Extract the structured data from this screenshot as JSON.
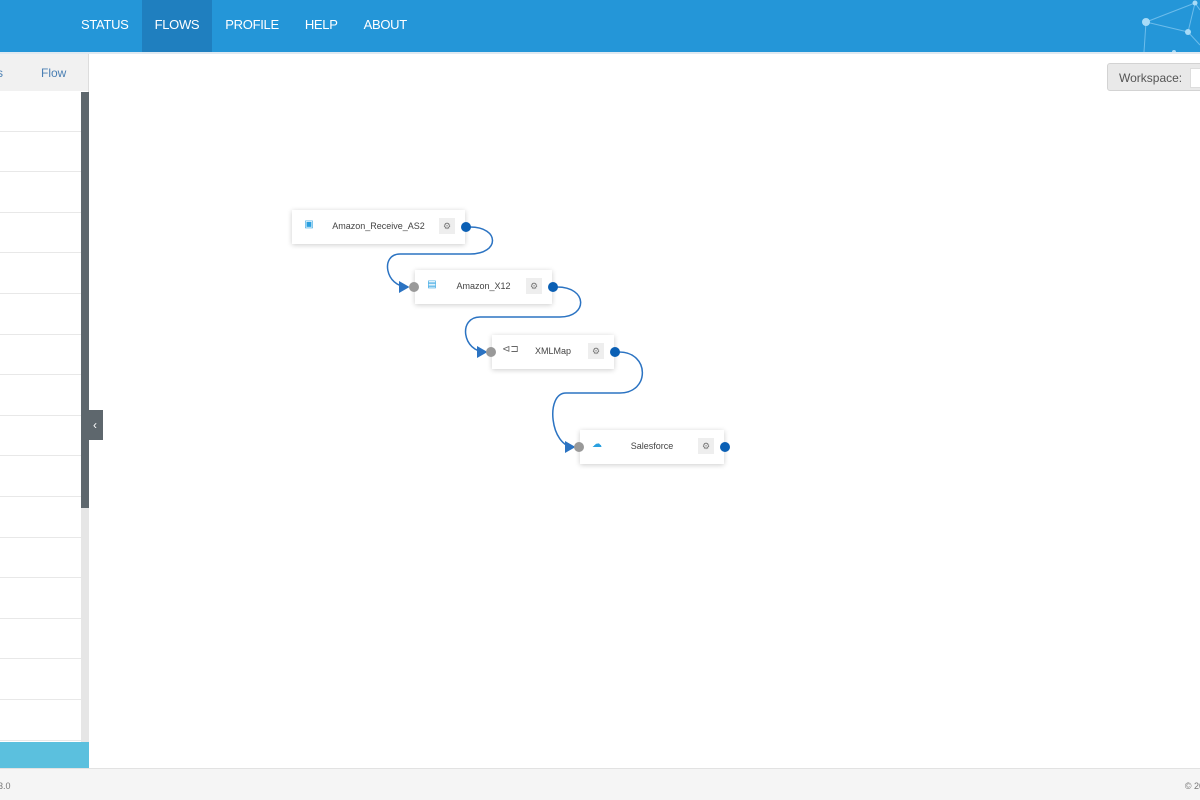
{
  "nav": {
    "items": [
      "STATUS",
      "FLOWS",
      "PROFILE",
      "HELP",
      "ABOUT"
    ],
    "active": "FLOWS"
  },
  "sidebar": {
    "tab_partial": "s",
    "tab_flow": "Flow",
    "collapse_icon": "‹"
  },
  "workspace": {
    "label": "Workspace:"
  },
  "flow": {
    "nodes": [
      {
        "name": "Amazon_Receive_AS2",
        "icon": "as2-icon"
      },
      {
        "name": "Amazon_X12",
        "icon": "x12-icon"
      },
      {
        "name": "XMLMap",
        "icon": "xmlmap-icon"
      },
      {
        "name": "Salesforce",
        "icon": "salesforce-icon"
      }
    ]
  },
  "footer": {
    "version": "3.0",
    "copyright": "© 20"
  },
  "colors": {
    "header": "#2496d8",
    "active_nav": "#1f7fbf",
    "port_out": "#0a5fb4",
    "link": "#2b73c2"
  }
}
